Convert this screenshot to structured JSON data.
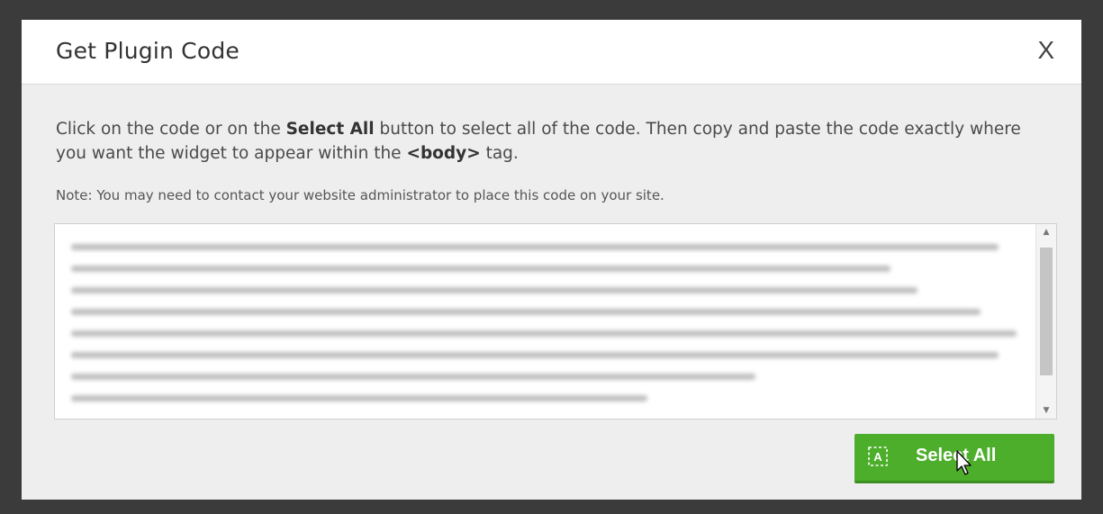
{
  "dialog": {
    "title": "Get Plugin Code",
    "close_label": "X"
  },
  "instructions": {
    "part1": "Click on the code or on the ",
    "bold1": "Select All",
    "part2": " button to select all of the code. Then copy and paste the code exactly where you want the widget to appear within the ",
    "bold2": "<body>",
    "part3": " tag."
  },
  "note": "Note: You may need to contact your website administrator to place this code on your site.",
  "code_box": {
    "content": "",
    "scroll_up_icon": "triangle-up-icon",
    "scroll_down_icon": "triangle-down-icon"
  },
  "select_all_button": {
    "label": "Select All",
    "icon": "select-all-icon",
    "color": "#4cae2a"
  },
  "colors": {
    "backdrop": "#3b3b3b",
    "modal_body": "#eeeeee",
    "header": "#ffffff"
  }
}
